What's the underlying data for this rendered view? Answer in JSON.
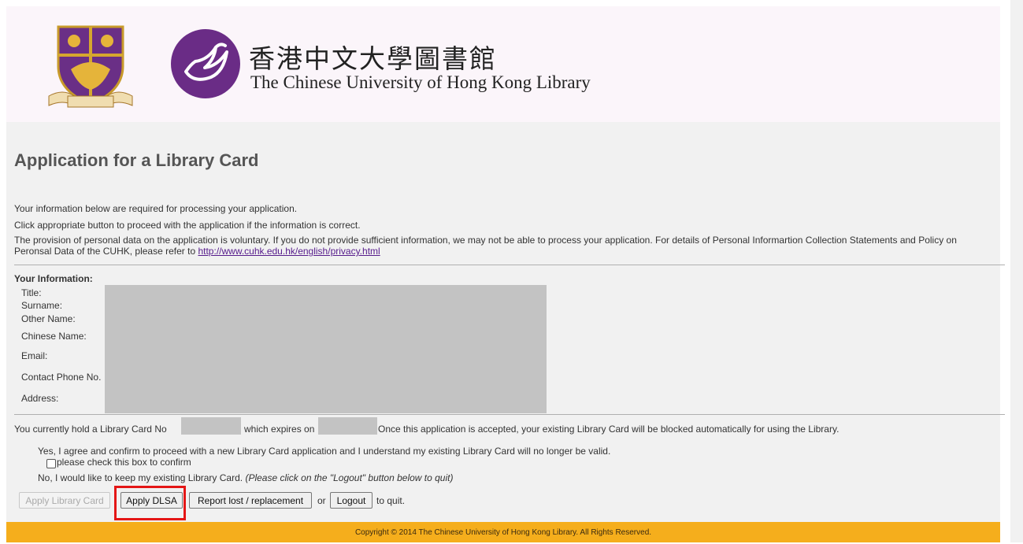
{
  "header": {
    "library_name_cn": "香港中文大學圖書館",
    "library_name_en": "The Chinese University of Hong Kong Library",
    "crest_icon": "cuhk-crest-icon",
    "swan_icon": "library-swan-logo-icon",
    "brand_purple": "#6a2c86"
  },
  "page": {
    "title": "Application for a Library Card",
    "intro_1": "Your information below are required for processing your application.",
    "intro_2": "Click appropriate button to proceed with the application if the information is correct.",
    "intro_3": "The provision of personal data on the application is voluntary. If you do not provide sufficient information, we may not be able to process your application. For details of Personal Informartion Collection Statements and Policy on Peronsal Data of the CUHK, please refer to",
    "privacy_link": "http://www.cuhk.edu.hk/english/privacy.html"
  },
  "info": {
    "heading": "Your Information:",
    "labels": [
      "Title:",
      "Surname:",
      "Other Name:",
      "Chinese Name:",
      "Email:",
      "Contact Phone No.",
      "Address:"
    ]
  },
  "card": {
    "prefix": "You currently hold a Library Card No",
    "middle": "which expires on",
    "suffix": "Once this application is accepted, your existing Library Card will be blocked automatically for using the Library."
  },
  "options": {
    "yes_text": "Yes, I agree and confirm to proceed with a new Library Card application and I understand my existing Library Card will no longer be valid.",
    "checkbox_label": "please check this box to confirm",
    "no_text": "No, I would like to keep my existing Library Card.",
    "no_note": "(Please click on the \"Logout\" button below to quit)"
  },
  "buttons": {
    "apply_card": "Apply Library Card",
    "apply_dlsa": "Apply DLSA",
    "report_lost": "Report lost / replacement",
    "or_text": "or",
    "logout": "Logout",
    "quit_text": "to quit."
  },
  "footer": {
    "copyright": "Copyright © 2014 The Chinese University of Hong Kong Library. All Rights Reserved.",
    "bar_color": "#f5ae1c"
  },
  "highlight_color": "#e41616"
}
